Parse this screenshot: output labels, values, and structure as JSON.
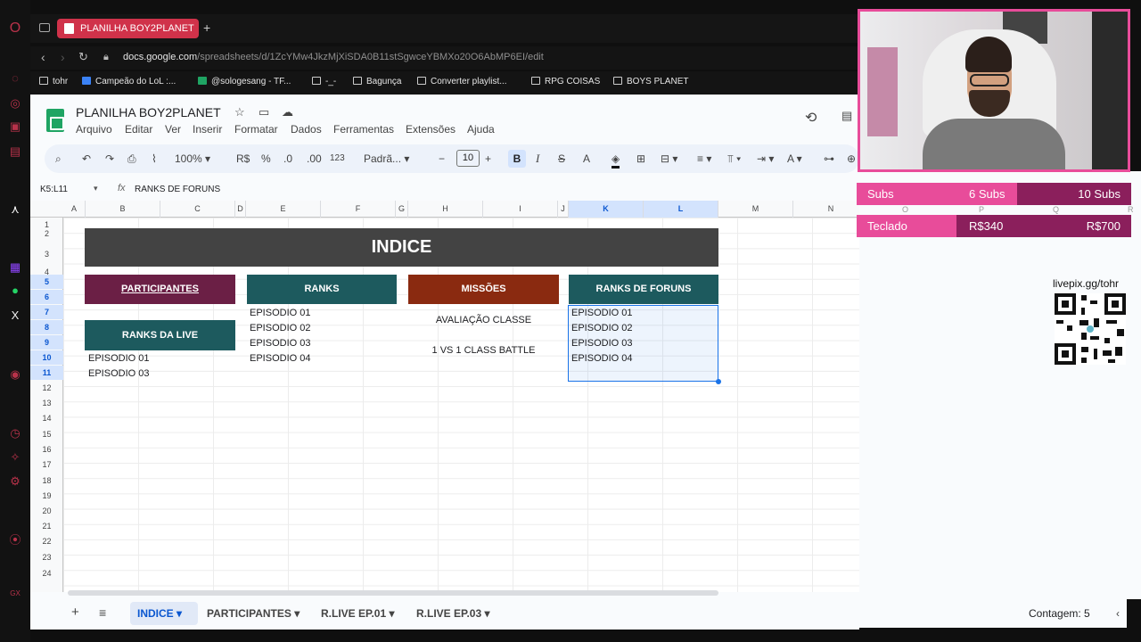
{
  "browser": {
    "tab_title": "PLANILHA BOY2PLANET",
    "url_domain": "docs.google.com",
    "url_path": "/spreadsheets/d/1ZcYMw4JkzMjXiSDA0B11stSgwceYBMXo20O6AbMP6EI/edit",
    "bookmarks": [
      "tohr",
      "Campeão do LoL :...",
      "@sologesang - TF...",
      "-_-",
      "Bagunça",
      "Converter playlist...",
      "RPG COISAS",
      "BOYS PLANET"
    ]
  },
  "sheets": {
    "title": "PLANILHA BOY2PLANET",
    "menu": [
      "Arquivo",
      "Editar",
      "Ver",
      "Inserir",
      "Formatar",
      "Dados",
      "Ferramentas",
      "Extensões",
      "Ajuda"
    ],
    "toolbar": {
      "zoom": "100%",
      "currency": "R$",
      "percent": "%",
      "dec_minus": ".0",
      "dec_plus": ".00",
      "number": "123",
      "font": "Padrã...",
      "font_size": "10",
      "bold": "B",
      "italic": "I",
      "text_color": "A"
    },
    "name_box": "K5:L11",
    "fx": "fx",
    "formula": "RANKS DE FORUNS",
    "columns": [
      "A",
      "B",
      "C",
      "D",
      "E",
      "F",
      "G",
      "H",
      "I",
      "J",
      "K",
      "L",
      "M",
      "N"
    ],
    "rows": [
      "1",
      "2",
      "3",
      "4",
      "5",
      "6",
      "7",
      "8",
      "9",
      "10",
      "11",
      "12",
      "13",
      "14",
      "15",
      "16",
      "17",
      "18",
      "19",
      "20",
      "21",
      "22",
      "23",
      "24"
    ],
    "content": {
      "indice": "INDICE",
      "participantes": "PARTICIPANTES",
      "ranks": "RANKS",
      "missoes": "MISSÕES",
      "ranks_foruns": "RANKS DE FORUNS",
      "ranks_live": "RANKS DA LIVE",
      "live_eps": [
        "EPISODIO 01",
        "EPISODIO 03"
      ],
      "ranks_eps": [
        "EPISODIO 01",
        "EPISODIO 02",
        "EPISODIO 03",
        "EPISODIO 04"
      ],
      "missoes_items": [
        "AVALIAÇÃO CLASSE",
        "1 VS 1 CLASS BATTLE"
      ],
      "foruns_eps": [
        "EPISODIO 01",
        "EPISODIO 02",
        "EPISODIO 03",
        "EPISODIO 04"
      ]
    },
    "sheet_tabs": [
      "INDICE",
      "PARTICIPANTES",
      "R.LIVE EP.01",
      "R.LIVE EP.03"
    ],
    "status": "Contagem: 5",
    "colors": {
      "participantes": "#6b1f45",
      "ranks": "#1d5a5e",
      "missoes": "#8a2a10",
      "foruns": "#1d5a5e",
      "header": "#434343"
    }
  },
  "overlay": {
    "goals": [
      {
        "label": "Subs",
        "mid": "6 Subs",
        "end": "10 Subs",
        "progress": 0.6
      },
      {
        "label": "Teclado",
        "mid": "R$340",
        "end": "R$700",
        "progress": 0.486
      }
    ],
    "livepix": "livepix.gg/tohr",
    "ghost_cols": [
      "O",
      "P",
      "Q",
      "R"
    ]
  }
}
